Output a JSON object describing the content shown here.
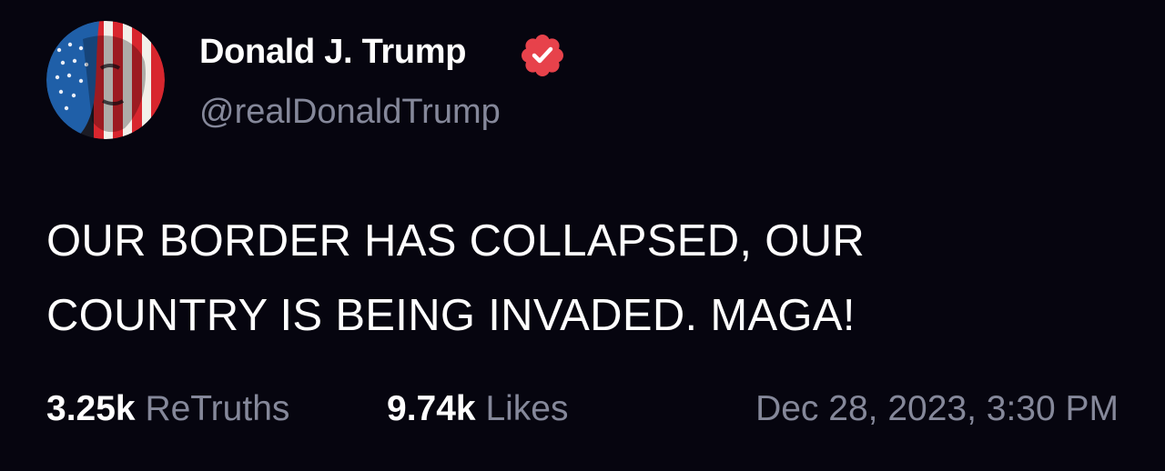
{
  "author": {
    "display_name": "Donald J. Trump",
    "handle": "@realDonaldTrump",
    "avatar_icon": "flag-portrait-avatar",
    "verified_icon": "verified-badge-icon",
    "verified_color": "#e7424b"
  },
  "post": {
    "text_line_1": "OUR BORDER HAS COLLAPSED, OUR",
    "text_line_2": "COUNTRY IS BEING INVADED. MAGA!"
  },
  "stats": {
    "retruths_count": "3.25k",
    "retruths_label": "ReTruths",
    "likes_count": "9.74k",
    "likes_label": "Likes"
  },
  "timestamp": "Dec 28, 2023, 3:30 PM",
  "colors": {
    "background": "#06050f",
    "primary_text": "#ffffff",
    "secondary_text": "#85889a"
  }
}
